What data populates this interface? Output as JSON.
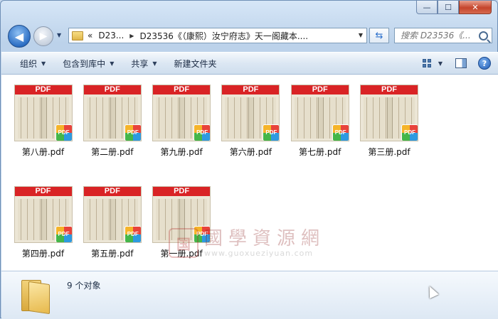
{
  "window": {
    "controls": {
      "minimize": "—",
      "maximize": "☐",
      "close": "✕"
    }
  },
  "nav": {
    "back_glyph": "◀",
    "forward_glyph": "▶"
  },
  "address": {
    "prefix": "«",
    "crumb1": "D23...",
    "crumb2": "D23536《（康熙）汝宁府志》天一阁藏本...."
  },
  "search": {
    "placeholder": "搜索 D23536《..."
  },
  "toolbar": {
    "organize": "组织",
    "include_in_library": "包含到库中",
    "share": "共享",
    "new_folder": "新建文件夹",
    "help": "?"
  },
  "files": [
    {
      "name": "第八册.pdf",
      "banner": "PDF",
      "badge": "PDF"
    },
    {
      "name": "第二册.pdf",
      "banner": "PDF",
      "badge": "PDF"
    },
    {
      "name": "第九册.pdf",
      "banner": "PDF",
      "badge": "PDF"
    },
    {
      "name": "第六册.pdf",
      "banner": "PDF",
      "badge": "PDF"
    },
    {
      "name": "第七册.pdf",
      "banner": "PDF",
      "badge": "PDF"
    },
    {
      "name": "第三册.pdf",
      "banner": "PDF",
      "badge": "PDF"
    },
    {
      "name": "第四册.pdf",
      "banner": "PDF",
      "badge": "PDF"
    },
    {
      "name": "第五册.pdf",
      "banner": "PDF",
      "badge": "PDF"
    },
    {
      "name": "第一册.pdf",
      "banner": "PDF",
      "badge": "PDF"
    }
  ],
  "watermark": {
    "seal": "国",
    "text": "國學資源網",
    "url": "www.guoxueziyuan.com"
  },
  "details": {
    "count": "9 个对象"
  }
}
